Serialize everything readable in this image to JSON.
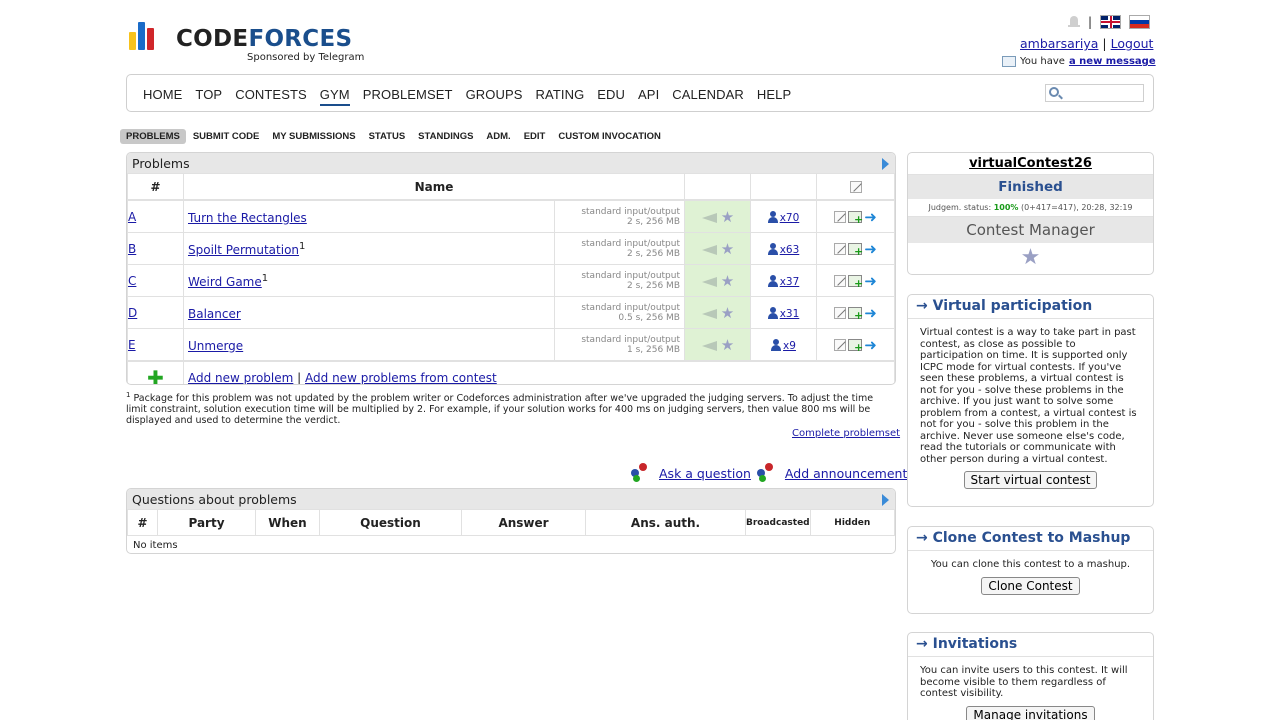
{
  "header": {
    "logo_text_code": "CODE",
    "logo_text_forces": "FORCES",
    "logo_sub": "Sponsored by Telegram",
    "username": "ambarsariya",
    "logout": "Logout",
    "message_prefix": "You have",
    "message_link": "a new message",
    "separator": "|"
  },
  "menu": {
    "items": [
      "HOME",
      "TOP",
      "CONTESTS",
      "GYM",
      "PROBLEMSET",
      "GROUPS",
      "RATING",
      "EDU",
      "API",
      "CALENDAR",
      "HELP"
    ],
    "active": "GYM"
  },
  "submenu": {
    "items": [
      "PROBLEMS",
      "SUBMIT CODE",
      "MY SUBMISSIONS",
      "STATUS",
      "STANDINGS",
      "ADM.",
      "EDIT",
      "CUSTOM INVOCATION"
    ],
    "active": "PROBLEMS"
  },
  "problems": {
    "title": "Problems",
    "col_index": "#",
    "col_name": "Name",
    "rows": [
      {
        "index": "A",
        "name": "Turn the Rectangles",
        "sup": "",
        "io": "standard input/output",
        "limits": "2 s, 256 MB",
        "solved": "x70"
      },
      {
        "index": "B",
        "name": "Spoilt Permutation",
        "sup": "1",
        "io": "standard input/output",
        "limits": "2 s, 256 MB",
        "solved": "x63"
      },
      {
        "index": "C",
        "name": "Weird Game",
        "sup": "1",
        "io": "standard input/output",
        "limits": "2 s, 256 MB",
        "solved": "x37"
      },
      {
        "index": "D",
        "name": "Balancer",
        "sup": "",
        "io": "standard input/output",
        "limits": "0.5 s, 256 MB",
        "solved": "x31"
      },
      {
        "index": "E",
        "name": "Unmerge",
        "sup": "",
        "io": "standard input/output",
        "limits": "1 s, 256 MB",
        "solved": "x9"
      }
    ],
    "add_problem": "Add new problem",
    "add_from_contest": "Add new problems from contest",
    "footnote_mark": "1",
    "footnote": "Package for this problem was not updated by the problem writer or Codeforces administration after we've upgraded the judging servers. To adjust the time limit constraint, solution execution time will be multiplied by 2. For example, if your solution works for 400 ms on judging servers, then value 800 ms will be displayed and used to determine the verdict.",
    "complete_problemset": "Complete problemset"
  },
  "actions": {
    "ask": "Ask a question",
    "announce": "Add announcement"
  },
  "questions": {
    "title": "Questions about problems",
    "columns": [
      "#",
      "Party",
      "When",
      "Question",
      "Answer",
      "Ans. auth.",
      "Broadcasted",
      "Hidden"
    ],
    "empty": "No items"
  },
  "contest": {
    "name": "virtualContest26",
    "status": "Finished",
    "judgem_label": "Judgem. status:",
    "judgem_percent": "100%",
    "judgem_rest": "(0+417=417), 20:28, 32:19",
    "manager": "Contest Manager"
  },
  "virtual": {
    "title": "→ Virtual participation",
    "text": "Virtual contest is a way to take part in past contest, as close as possible to participation on time. It is supported only ICPC mode for virtual contests. If you've seen these problems, a virtual contest is not for you - solve these problems in the archive. If you just want to solve some problem from a contest, a virtual contest is not for you - solve this problem in the archive. Never use someone else's code, read the tutorials or communicate with other person during a virtual contest.",
    "button": "Start virtual contest"
  },
  "clone": {
    "title": "→ Clone Contest to Mashup",
    "text": "You can clone this contest to a mashup.",
    "button": "Clone Contest"
  },
  "invitations": {
    "title": "→ Invitations",
    "text": "You can invite users to this contest. It will become visible to them regardless of contest visibility.",
    "button": "Manage invitations"
  }
}
